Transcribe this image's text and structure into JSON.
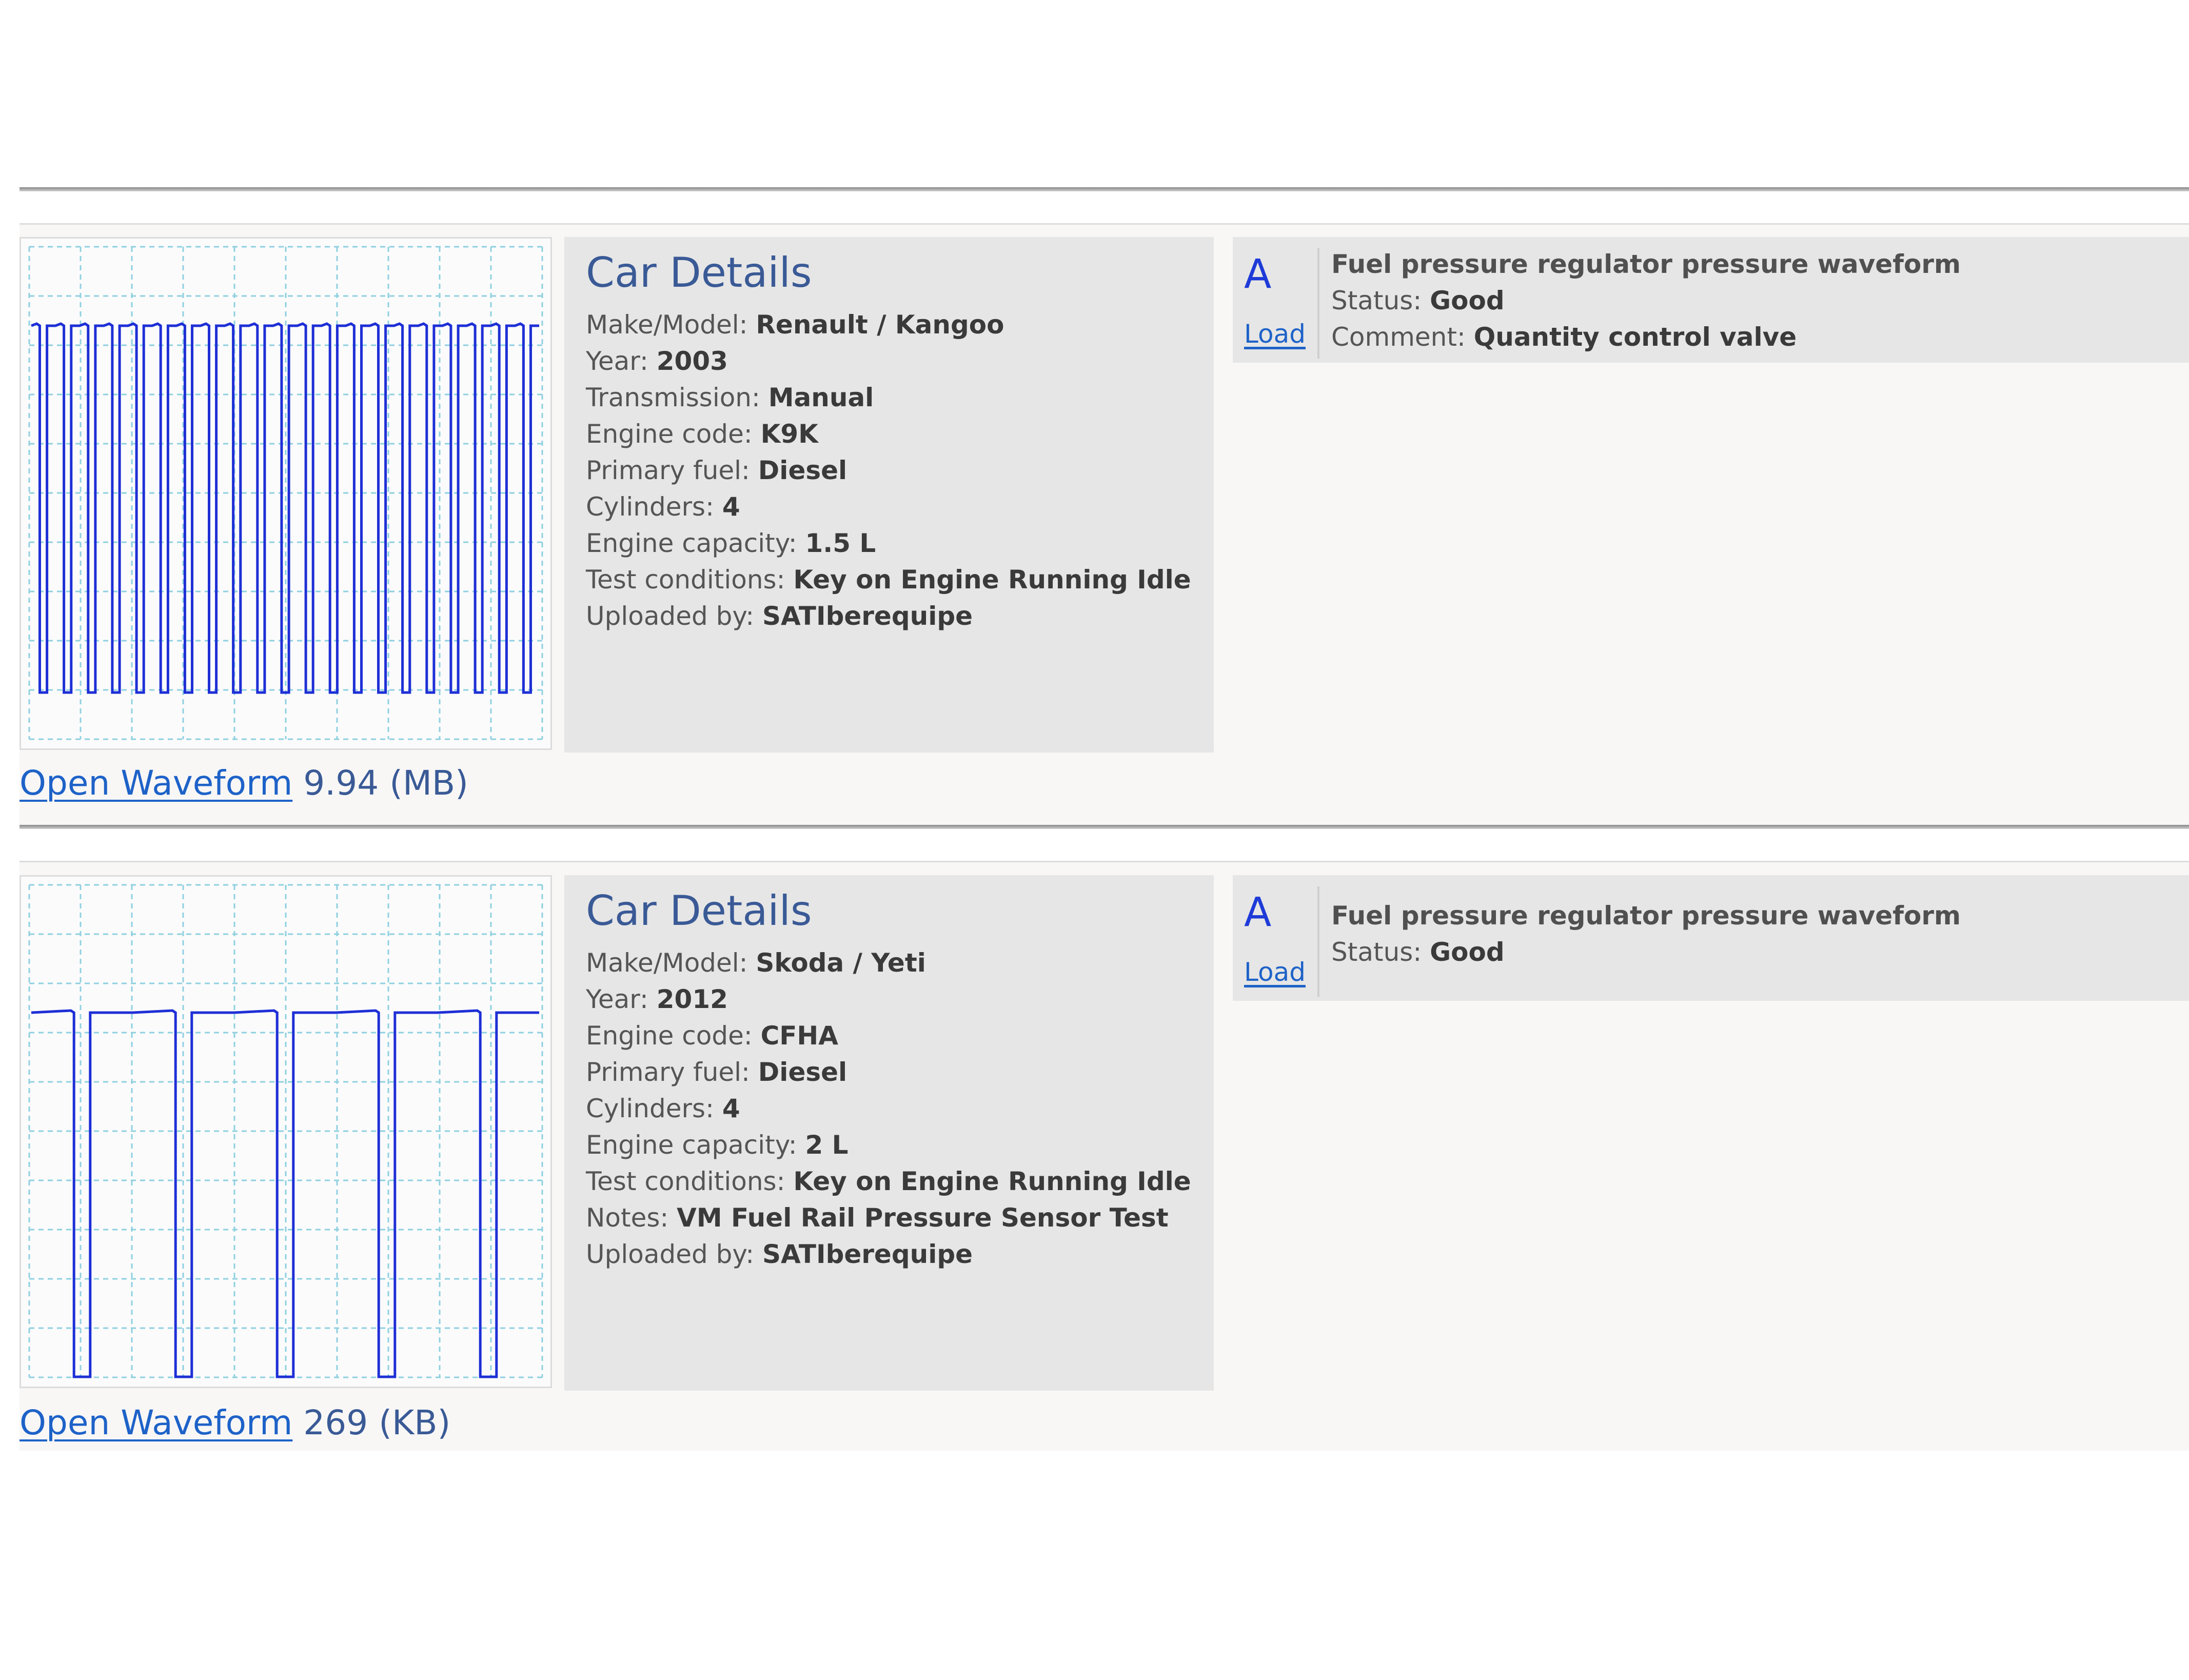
{
  "entries": [
    {
      "details_heading": "Car Details",
      "fields": [
        {
          "label": "Make/Model: ",
          "value": "Renault / Kangoo"
        },
        {
          "label": "Year: ",
          "value": "2003"
        },
        {
          "label": "Transmission: ",
          "value": "Manual"
        },
        {
          "label": "Engine code: ",
          "value": "K9K"
        },
        {
          "label": "Primary fuel: ",
          "value": "Diesel"
        },
        {
          "label": "Cylinders: ",
          "value": "4"
        },
        {
          "label": "Engine capacity: ",
          "value": "1.5 L"
        },
        {
          "label": "Test conditions: ",
          "value": "Key on Engine Running Idle"
        },
        {
          "label": "Uploaded by: ",
          "value": "SATIberequipe"
        }
      ],
      "open_waveform_label": "Open Waveform",
      "file_size": "9.94 (MB)",
      "result": {
        "channel": "A",
        "load_label": "Load",
        "title": "Fuel pressure regulator pressure waveform",
        "status_label": "Status: ",
        "status": "Good",
        "comment_label": "Comment: ",
        "comment": "Quantity control valve"
      },
      "waveform": {
        "pulse_count": 21,
        "trace_color": "#1e2fd6"
      }
    },
    {
      "details_heading": "Car Details",
      "fields": [
        {
          "label": "Make/Model: ",
          "value": "Skoda / Yeti"
        },
        {
          "label": "Year: ",
          "value": "2012"
        },
        {
          "label": "Engine code: ",
          "value": "CFHA"
        },
        {
          "label": "Primary fuel: ",
          "value": "Diesel"
        },
        {
          "label": "Cylinders: ",
          "value": "4"
        },
        {
          "label": "Engine capacity: ",
          "value": "2 L"
        },
        {
          "label": "Test conditions: ",
          "value": "Key on Engine Running Idle"
        },
        {
          "label": "Notes: ",
          "value": "VM Fuel Rail Pressure Sensor Test"
        },
        {
          "label": "Uploaded by: ",
          "value": "SATIberequipe"
        }
      ],
      "open_waveform_label": "Open Waveform",
      "file_size": "269 (KB)",
      "result": {
        "channel": "A",
        "load_label": "Load",
        "title": "Fuel pressure regulator pressure waveform",
        "status_label": "Status: ",
        "status": "Good"
      },
      "waveform": {
        "pulse_count": 5,
        "trace_color": "#1e2fd6"
      }
    }
  ]
}
